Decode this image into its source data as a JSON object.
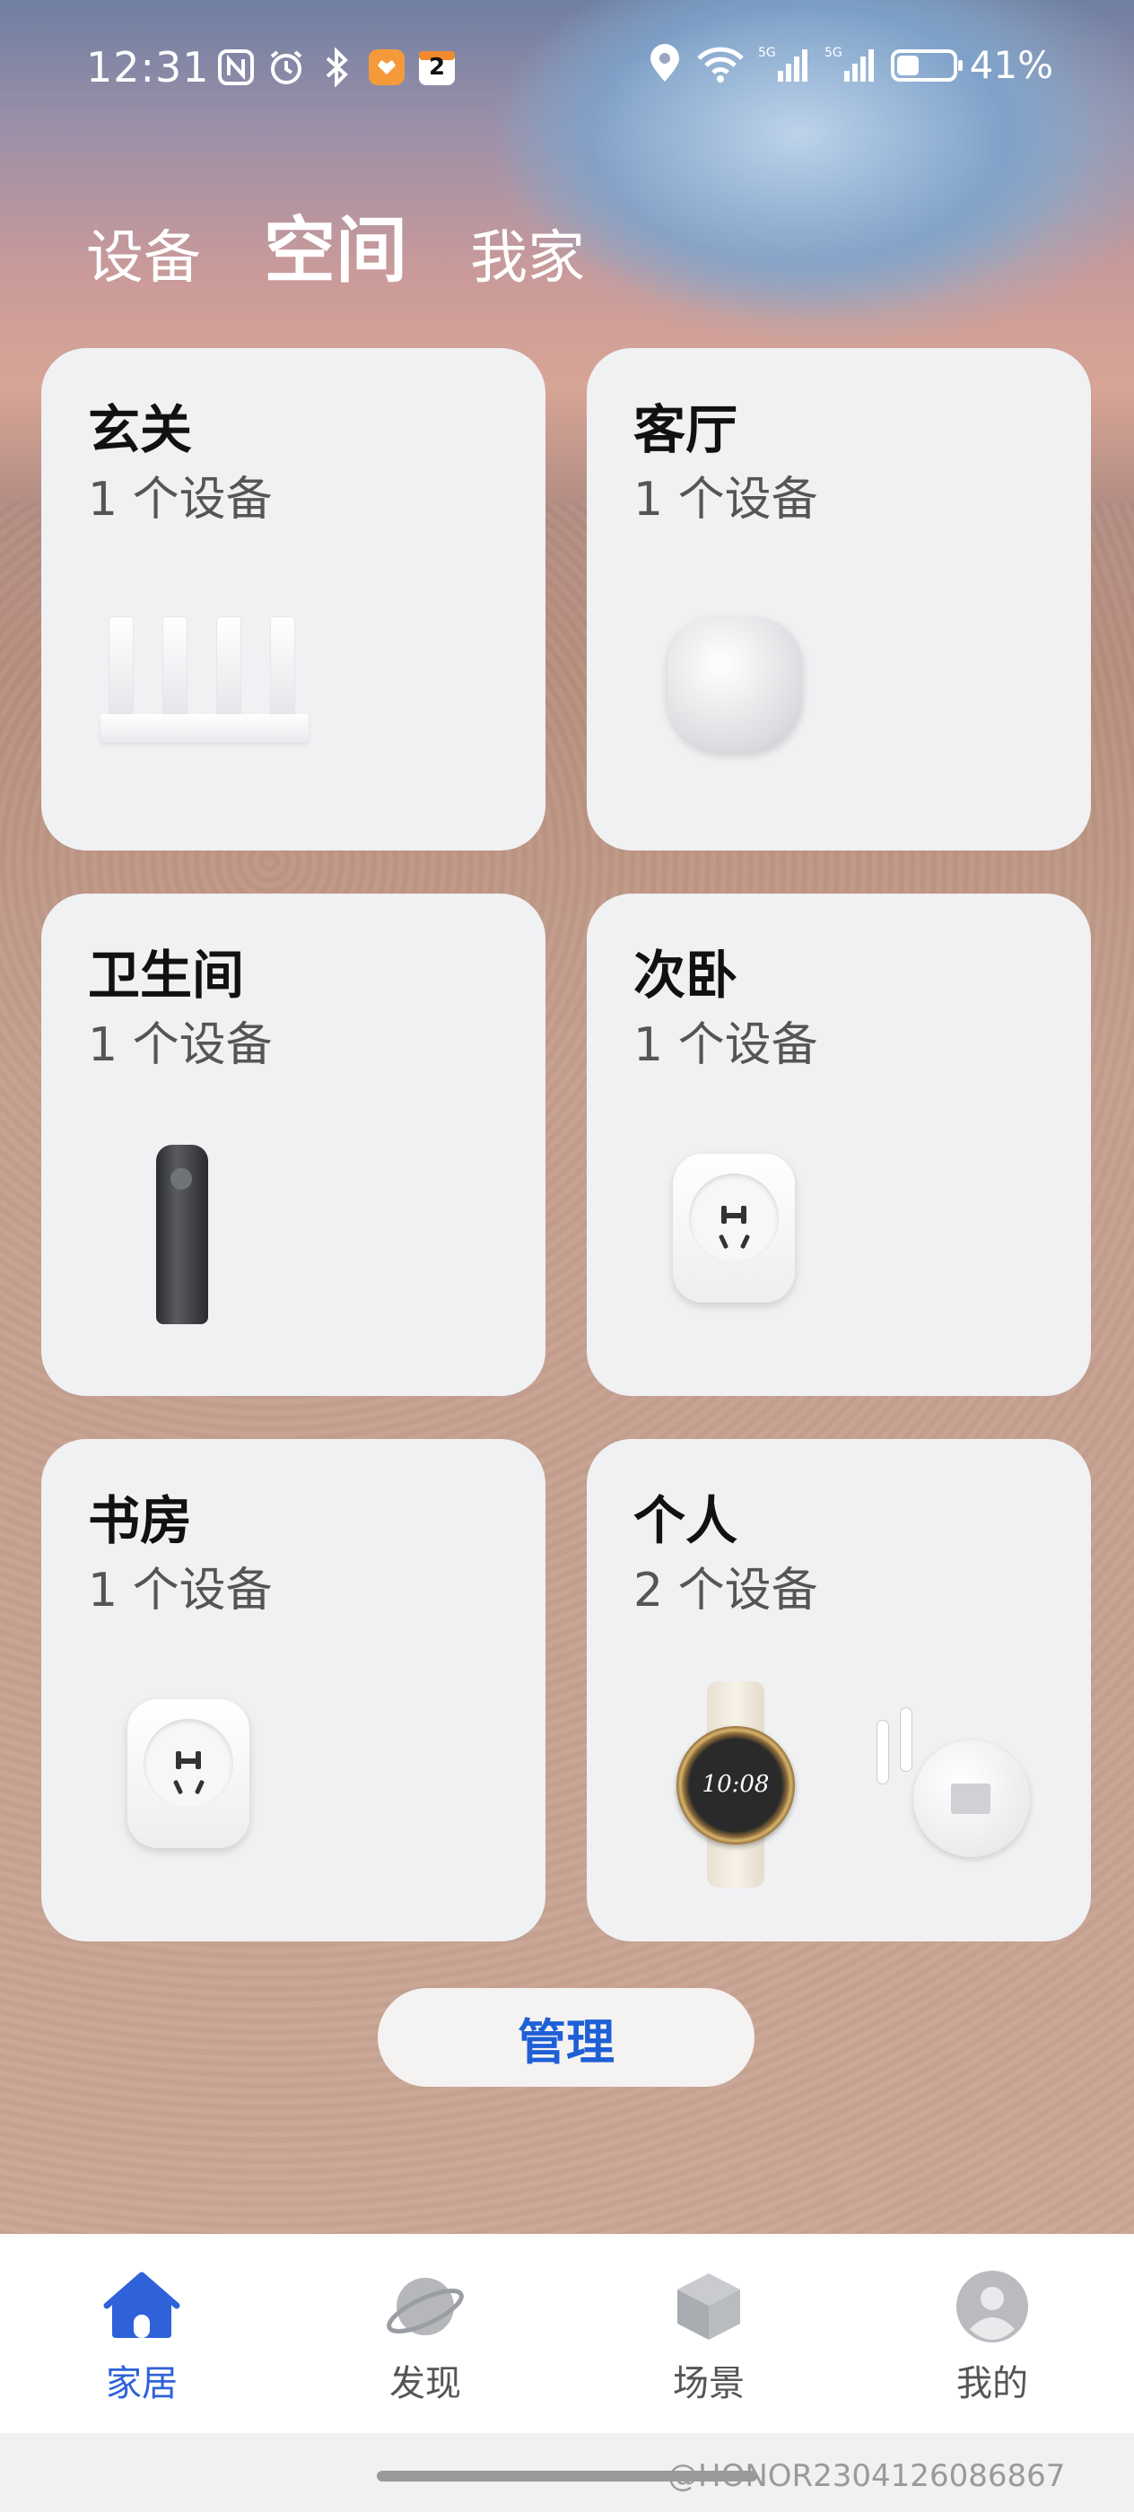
{
  "status": {
    "time": "12:31",
    "left_icons": [
      "nfc-icon",
      "alarm-icon",
      "bluetooth-icon",
      "app-badge-icon",
      "calendar-icon"
    ],
    "calendar_badge": "2",
    "right_icons": [
      "location-icon",
      "wifi-icon",
      "signal-5g-icon",
      "signal-5g-icon"
    ],
    "battery_percent": "41%",
    "battery_level": 0.41
  },
  "top_tabs": [
    {
      "label": "设备",
      "active": false
    },
    {
      "label": "空间",
      "active": true
    },
    {
      "label": "我家",
      "active": false
    }
  ],
  "rooms": [
    {
      "name": "玄关",
      "count": "1 个设备",
      "devices": [
        "router"
      ]
    },
    {
      "name": "客厅",
      "count": "1 个设备",
      "devices": [
        "smart-speaker"
      ]
    },
    {
      "name": "卫生间",
      "count": "1 个设备",
      "devices": [
        "shaver"
      ]
    },
    {
      "name": "次卧",
      "count": "1 个设备",
      "devices": [
        "smart-plug"
      ]
    },
    {
      "name": "书房",
      "count": "1 个设备",
      "devices": [
        "smart-plug"
      ]
    },
    {
      "name": "个人",
      "count": "2 个设备",
      "devices": [
        "smart-watch",
        "earbuds"
      ]
    }
  ],
  "watch_time": "10:08",
  "manage_button": "管理",
  "bottom_nav": [
    {
      "label": "家居",
      "icon": "home-icon",
      "active": true
    },
    {
      "label": "发现",
      "icon": "planet-icon",
      "active": false
    },
    {
      "label": "场景",
      "icon": "cube-icon",
      "active": false
    },
    {
      "label": "我的",
      "icon": "user-icon",
      "active": false
    }
  ],
  "watermark": "@HONOR2304126086867",
  "colors": {
    "accent": "#2f62d8",
    "card": "#f0f1f3",
    "manage_text": "#1f5fd6"
  }
}
